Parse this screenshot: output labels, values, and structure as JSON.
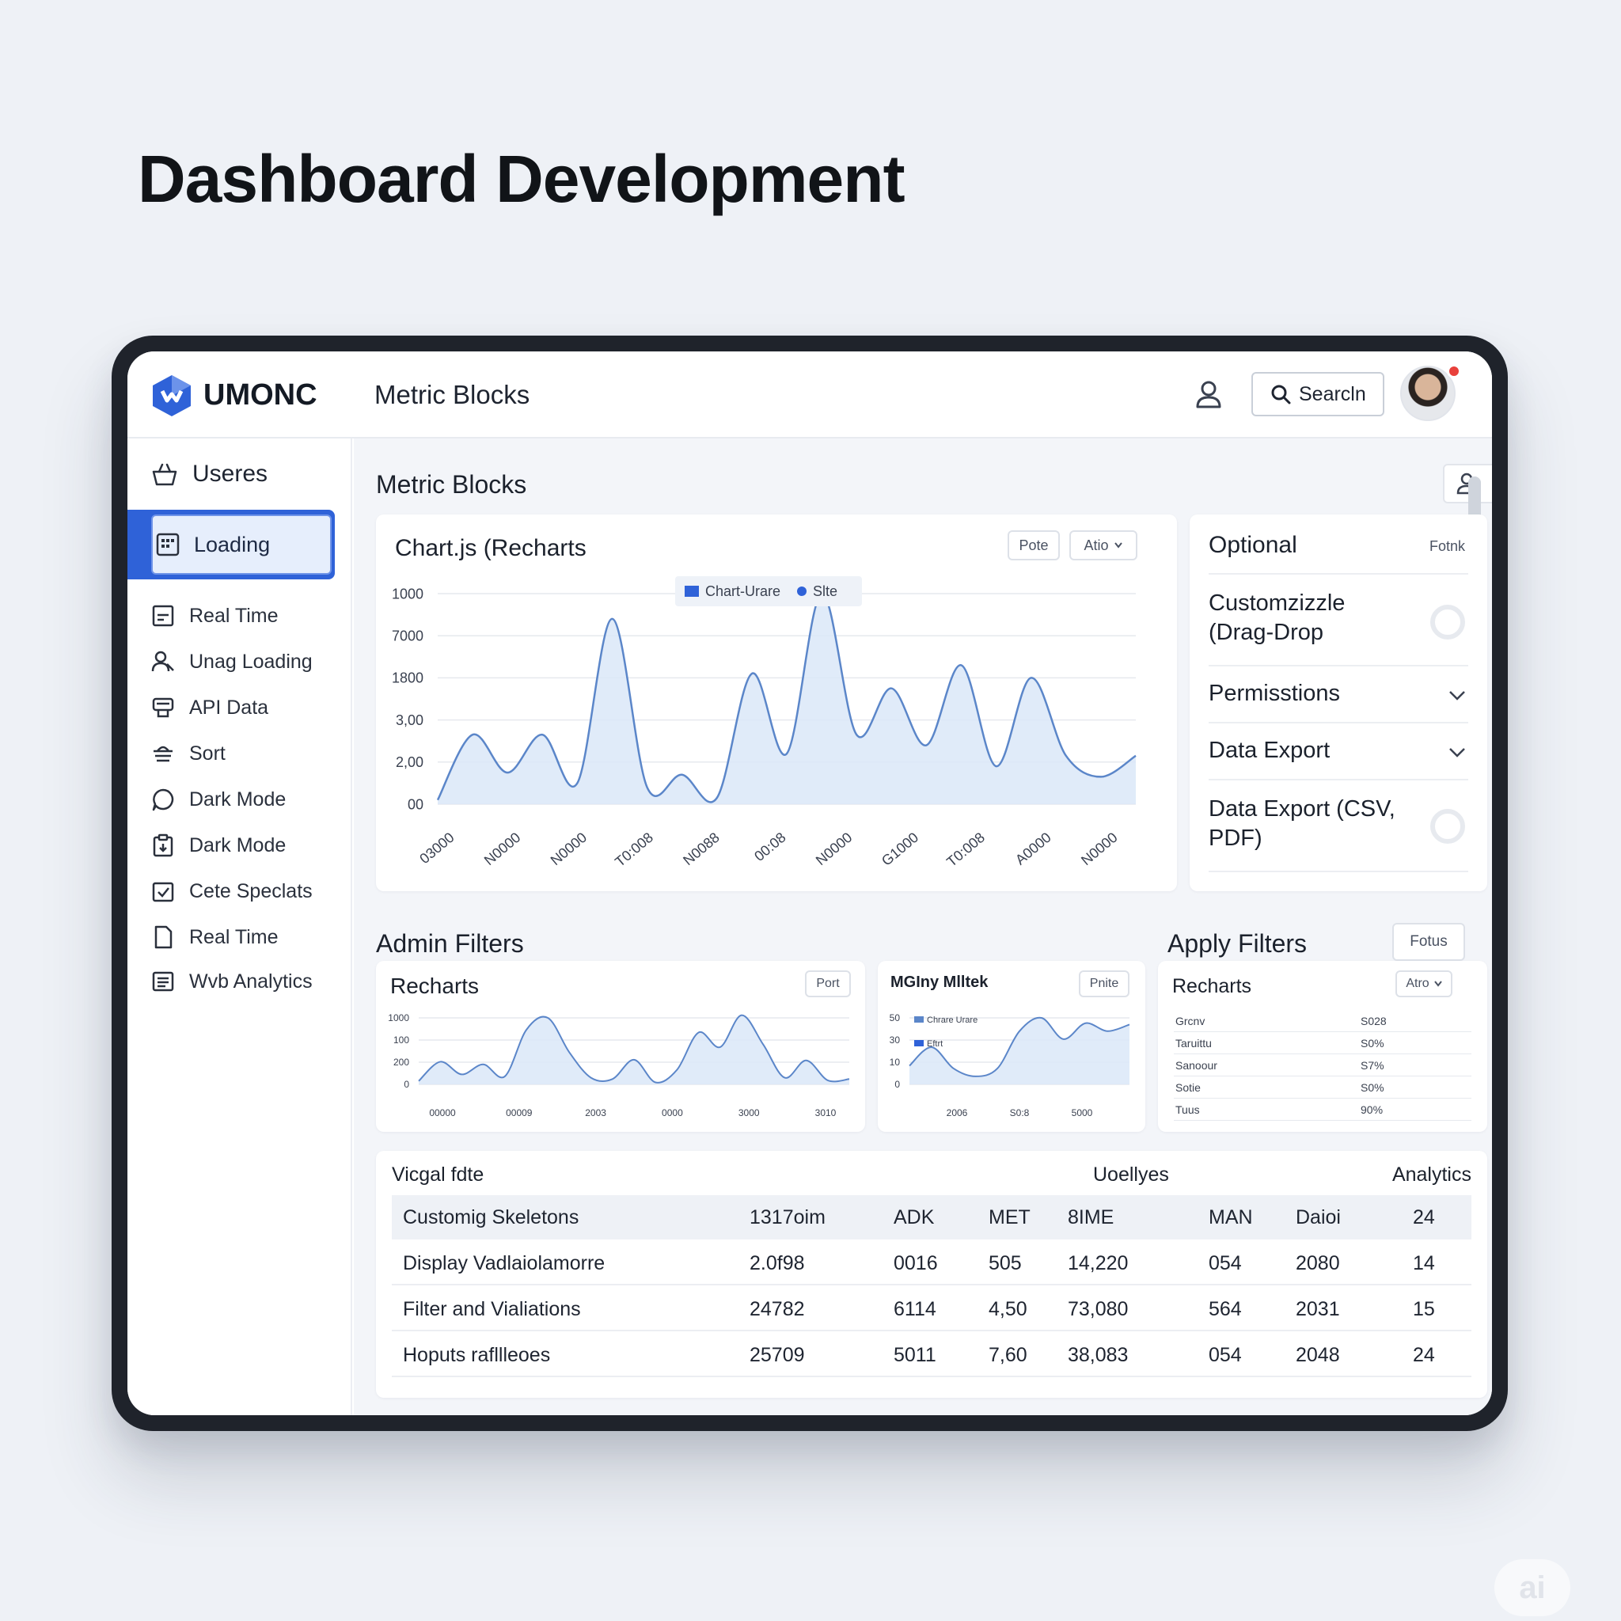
{
  "page": {
    "heading": "Dashboard Development"
  },
  "topbar": {
    "brand": "UMONC",
    "title": "Metric Blocks",
    "search_label": "Searcln"
  },
  "sidebar": {
    "header": "Useres",
    "items": [
      {
        "label": "Loading",
        "icon": "grid-icon",
        "active": true
      },
      {
        "label": "Real Time",
        "icon": "chart-icon"
      },
      {
        "label": "Unag Loading",
        "icon": "users-icon"
      },
      {
        "label": "API Data",
        "icon": "database-icon"
      },
      {
        "label": "Sort",
        "icon": "sort-icon"
      },
      {
        "label": "Dark Mode",
        "icon": "chat-icon"
      },
      {
        "label": "Dark Mode",
        "icon": "clipboard-icon"
      },
      {
        "label": "Cete Speclats",
        "icon": "checkbox-icon"
      },
      {
        "label": "Real Time",
        "icon": "file-icon"
      },
      {
        "label": "Wvb Analytics",
        "icon": "list-icon"
      }
    ]
  },
  "main": {
    "title": "Metric Blocks",
    "chart_card": {
      "title": "Chart.js (Recharts",
      "btn_a": "Pote",
      "btn_b": "Atio",
      "legend": [
        "Chart-Urare",
        "Slte"
      ]
    },
    "optional_card": {
      "title": "Optional",
      "action": "Fotnk",
      "rows": [
        {
          "label": "Customzizzle (Drag-Drop",
          "control": "ring"
        },
        {
          "label": "Permisstions",
          "control": "chevron"
        },
        {
          "label": "Data Export",
          "control": "chevron"
        },
        {
          "label": "Data Export (CSV, PDF)",
          "control": "ring"
        }
      ]
    },
    "admin_filters_title": "Admin Filters",
    "apply_filters_title": "Apply Filters",
    "apply_filters_btn": "Fotus",
    "recharts_card": {
      "title": "Recharts",
      "btn": "Port"
    },
    "mini_card": {
      "title": "MGIny Mlltek",
      "btn": "Pnite",
      "legend": [
        "Chrare Urare",
        "Eftrt"
      ]
    },
    "filter_list_card": {
      "title": "Recharts",
      "btn": "Atro",
      "rows": [
        {
          "name": "Grcnv",
          "value": "S028"
        },
        {
          "name": "Taruittu",
          "value": "S0%"
        },
        {
          "name": "Sanoour",
          "value": "S7%"
        },
        {
          "name": "Sotie",
          "value": "S0%"
        },
        {
          "name": "Tuus",
          "value": "90%"
        }
      ]
    },
    "table": {
      "labels": {
        "left": "Vicgal fdte",
        "middle": "Uoellyes",
        "right": "Analytics"
      },
      "rows": [
        [
          "Customig Skeletons",
          "1317oim",
          "ADK",
          "MET",
          "8IME",
          "MAN",
          "Daioi",
          "24"
        ],
        [
          "Display Vadlaiolamorre",
          "2.0f98",
          "0016",
          "505",
          "14,220",
          "054",
          "2080",
          "14"
        ],
        [
          "Filter and Vialiations",
          "24782",
          "6114",
          "4,50",
          "73,080",
          "564",
          "2031",
          "15"
        ],
        [
          "Hoputs rafllleoes",
          "25709",
          "5011",
          "7,60",
          "38,083",
          "054",
          "2048",
          "24"
        ]
      ]
    }
  },
  "chart_data": [
    {
      "type": "area",
      "y_tick_labels": [
        "1000",
        "7000",
        "1800",
        "3,00",
        "2,00",
        "00"
      ],
      "x_tick_labels": [
        "03000",
        "N0000",
        "N0000",
        "T0:008",
        "N0088",
        "00:08",
        "N0000",
        "G1000",
        "T0:008",
        "A0000",
        "N0000"
      ],
      "ylim": [
        0,
        1000
      ],
      "x": [
        0,
        0.5,
        1,
        1.5,
        2,
        2.5,
        3,
        3.5,
        4,
        4.5,
        5,
        5.5,
        6,
        6.5,
        7,
        7.5,
        8,
        8.5,
        9,
        9.5,
        10
      ],
      "values": [
        20,
        330,
        150,
        330,
        100,
        880,
        80,
        140,
        30,
        620,
        240,
        1000,
        330,
        550,
        280,
        660,
        180,
        600,
        230,
        130,
        230
      ],
      "colors": {
        "line": "#5b86c9",
        "fill": "#dbe7f8"
      }
    },
    {
      "type": "area",
      "y_tick_labels": [
        "1000",
        "100",
        "200",
        "0"
      ],
      "x_tick_labels": [
        "00000",
        "00009",
        "2003",
        "0000",
        "3000",
        "3010"
      ],
      "ylim": [
        0,
        1000
      ],
      "values": [
        50,
        340,
        150,
        300,
        120,
        820,
        1000,
        480,
        100,
        80,
        370,
        30,
        220,
        780,
        560,
        1040,
        600,
        100,
        360,
        60,
        80
      ],
      "colors": {
        "line": "#5b86c9",
        "fill": "#dbe7f8"
      }
    },
    {
      "type": "area",
      "y_tick_labels": [
        "50",
        "30",
        "10",
        "0"
      ],
      "x_tick_labels": [
        "2006",
        "S0:8",
        "5000"
      ],
      "ylim": [
        0,
        50
      ],
      "values": [
        14,
        28,
        12,
        6,
        12,
        40,
        50,
        34,
        46,
        40,
        45
      ],
      "colors": {
        "line": "#5b86c9",
        "fill": "#dbe7f8"
      }
    }
  ],
  "colors": {
    "accent": "#2f62d8",
    "background": "#eef1f6",
    "frame": "#1f232b"
  }
}
